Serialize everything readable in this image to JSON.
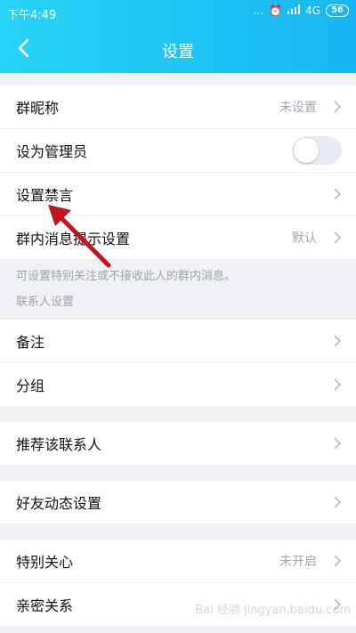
{
  "status_bar": {
    "time": "下午4:49",
    "signal_dots": "...",
    "network": "4G",
    "battery": "56"
  },
  "nav": {
    "title": "设置",
    "back_icon": "chevron-left-icon"
  },
  "group1": [
    {
      "label": "群昵称",
      "value": "未设置"
    },
    {
      "label": "设为管理员",
      "toggle": false
    },
    {
      "label": "设置禁言",
      "value": ""
    },
    {
      "label": "群内消息提示设置",
      "value": "默认"
    }
  ],
  "group1_note": "可设置特别关注或不接收此人的群内消息。",
  "contact_section": {
    "title": "联系人设置",
    "items": [
      {
        "label": "备注"
      },
      {
        "label": "分组"
      }
    ]
  },
  "group3": [
    {
      "label": "推荐该联系人"
    }
  ],
  "group4": [
    {
      "label": "好友动态设置"
    }
  ],
  "group5": [
    {
      "label": "特别关心",
      "value": "未开启"
    },
    {
      "label": "亲密关系"
    }
  ],
  "watermark": "Bai 经验 jingyan.baidu.com",
  "colors": {
    "header_start": "#27d3f5",
    "header_end": "#18b6f4",
    "arrow": "#c0151b",
    "toggle_off": "#e7eaf0"
  }
}
